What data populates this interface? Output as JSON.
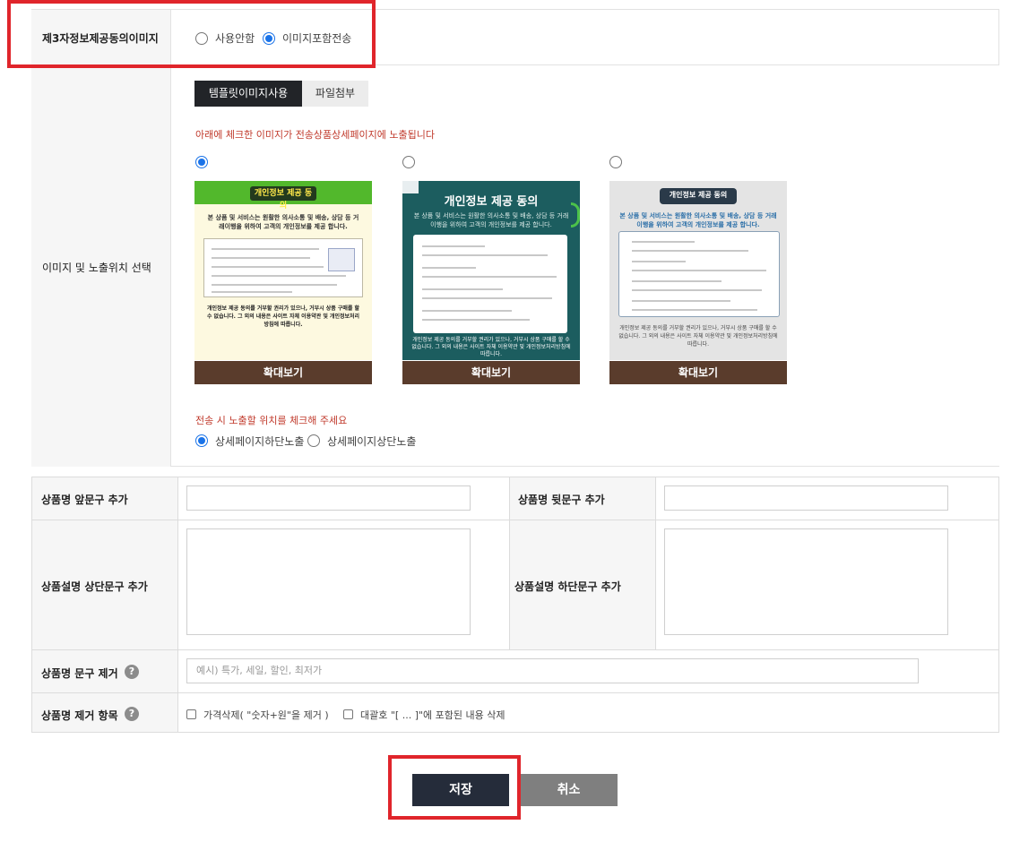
{
  "third_party_consent": {
    "label": "제3자정보제공동의이미지",
    "options": [
      "사용안함",
      "이미지포함전송"
    ],
    "selected": "이미지포함전송"
  },
  "image_position": {
    "label": "이미지 및 노출위치 선택",
    "tabs": [
      "템플릿이미지사용",
      "파일첨부"
    ],
    "active_tab": "템플릿이미지사용",
    "notice": "아래에 체크한 이미지가 전송상품상세페이지에 노출됩니다",
    "templates": [
      {
        "selected": true,
        "header": "개인정보 제공 동의",
        "intro": "본 상품 및 서비스는 원활한 의사소통 및 배송, 상담 등 거래이행을 위하여 고객의 개인정보를 제공 합니다.",
        "outro": "개인정보 제공 동의를 거부할 권리가 있으나, 거부시 상품 구매를 할 수 없습니다. 그 외의 내용은 사이트 자체 이용약관 및 개인정보처리방침에 따릅니다.",
        "zoom_label": "확대보기"
      },
      {
        "selected": false,
        "header": "개인정보 제공 동의",
        "intro": "본 상품 및 서비스는 원활한 의사소통 및 배송, 상담 등 거래이행을 위하여 고객의 개인정보를 제공 합니다.",
        "outro": "개인정보 제공 동의를 거부할 권리가 있으나, 거부시 상품 구매를 할 수 없습니다. 그 외의 내용은 사이트 자체 이용약관 및 개인정보처리방침에 따릅니다.",
        "zoom_label": "확대보기"
      },
      {
        "selected": false,
        "header": "개인정보 제공 동의",
        "intro": "본 상품 및 서비스는 원활한 의사소통 및 배송, 상담 등 거래이행을 위하여 고객의 개인정보를 제공 합니다.",
        "outro": "개인정보 제공 동의를 거부할 권리가 있으나, 거부시 상품 구매를 할 수 없습니다. 그 외의 내용은 사이트 자체 이용약관 및 개인정보처리방침에 따릅니다.",
        "zoom_label": "확대보기"
      }
    ],
    "position_notice": "전송 시 노출할 위치를 체크해 주세요",
    "position_options": [
      "상세페이지하단노출",
      "상세페이지상단노출"
    ],
    "position_selected": "상세페이지하단노출"
  },
  "product_fields": {
    "prefix_label": "상품명 앞문구 추가",
    "prefix_value": "",
    "suffix_label": "상품명 뒷문구 추가",
    "suffix_value": "",
    "desc_top_label": "상품설명 상단문구 추가",
    "desc_bottom_label": "상품설명 하단문구 추가",
    "remove_words_label": "상품명 문구 제거",
    "remove_words_placeholder": "예시) 특가, 세일, 할인, 최저가",
    "remove_items_label": "상품명 제거 항목",
    "remove_items": [
      {
        "label": "가격삭제( \"숫자+원\"을 제거 )",
        "checked": false
      },
      {
        "label": "대괄호 \"[ ... ]\"에 포함된 내용 삭제",
        "checked": false
      }
    ],
    "help_icon_char": "?"
  },
  "actions": {
    "save_label": "저장",
    "cancel_label": "취소"
  },
  "colors": {
    "highlight": "#e0252b",
    "save_button": "#252c3a",
    "cancel_button": "#7f7f7f",
    "zoom_button": "#5a3c2c",
    "notice_text": "#c0392b",
    "radio_selected": "#1a73e8"
  }
}
